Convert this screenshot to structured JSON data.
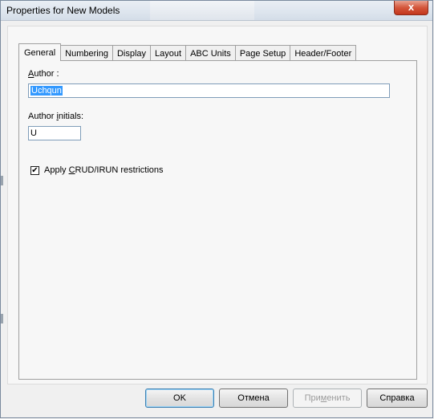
{
  "window": {
    "title": "Properties for New Models",
    "close_glyph": "x"
  },
  "tabs": [
    {
      "label": "General",
      "active": true
    },
    {
      "label": "Numbering"
    },
    {
      "label": "Display"
    },
    {
      "label": "Layout"
    },
    {
      "label": "ABC Units"
    },
    {
      "label": "Page Setup"
    },
    {
      "label": "Header/Footer"
    }
  ],
  "general": {
    "author_label_u": "A",
    "author_label_rest": "uthor :",
    "author_value": "Uchqun",
    "initials_label_a": "Author ",
    "initials_label_u": "i",
    "initials_label_b": "nitials:",
    "initials_value": "U",
    "crud_checked": true,
    "crud_label_a": "Apply ",
    "crud_label_u": "C",
    "crud_label_b": "RUD/IRUN restrictions"
  },
  "buttons": {
    "ok": "OK",
    "cancel": "Отмена",
    "apply_a": "При",
    "apply_u": "м",
    "apply_b": "енить",
    "help": "Справка"
  },
  "colors": {
    "selection": "#3399ff",
    "close_button": "#c3361c"
  }
}
